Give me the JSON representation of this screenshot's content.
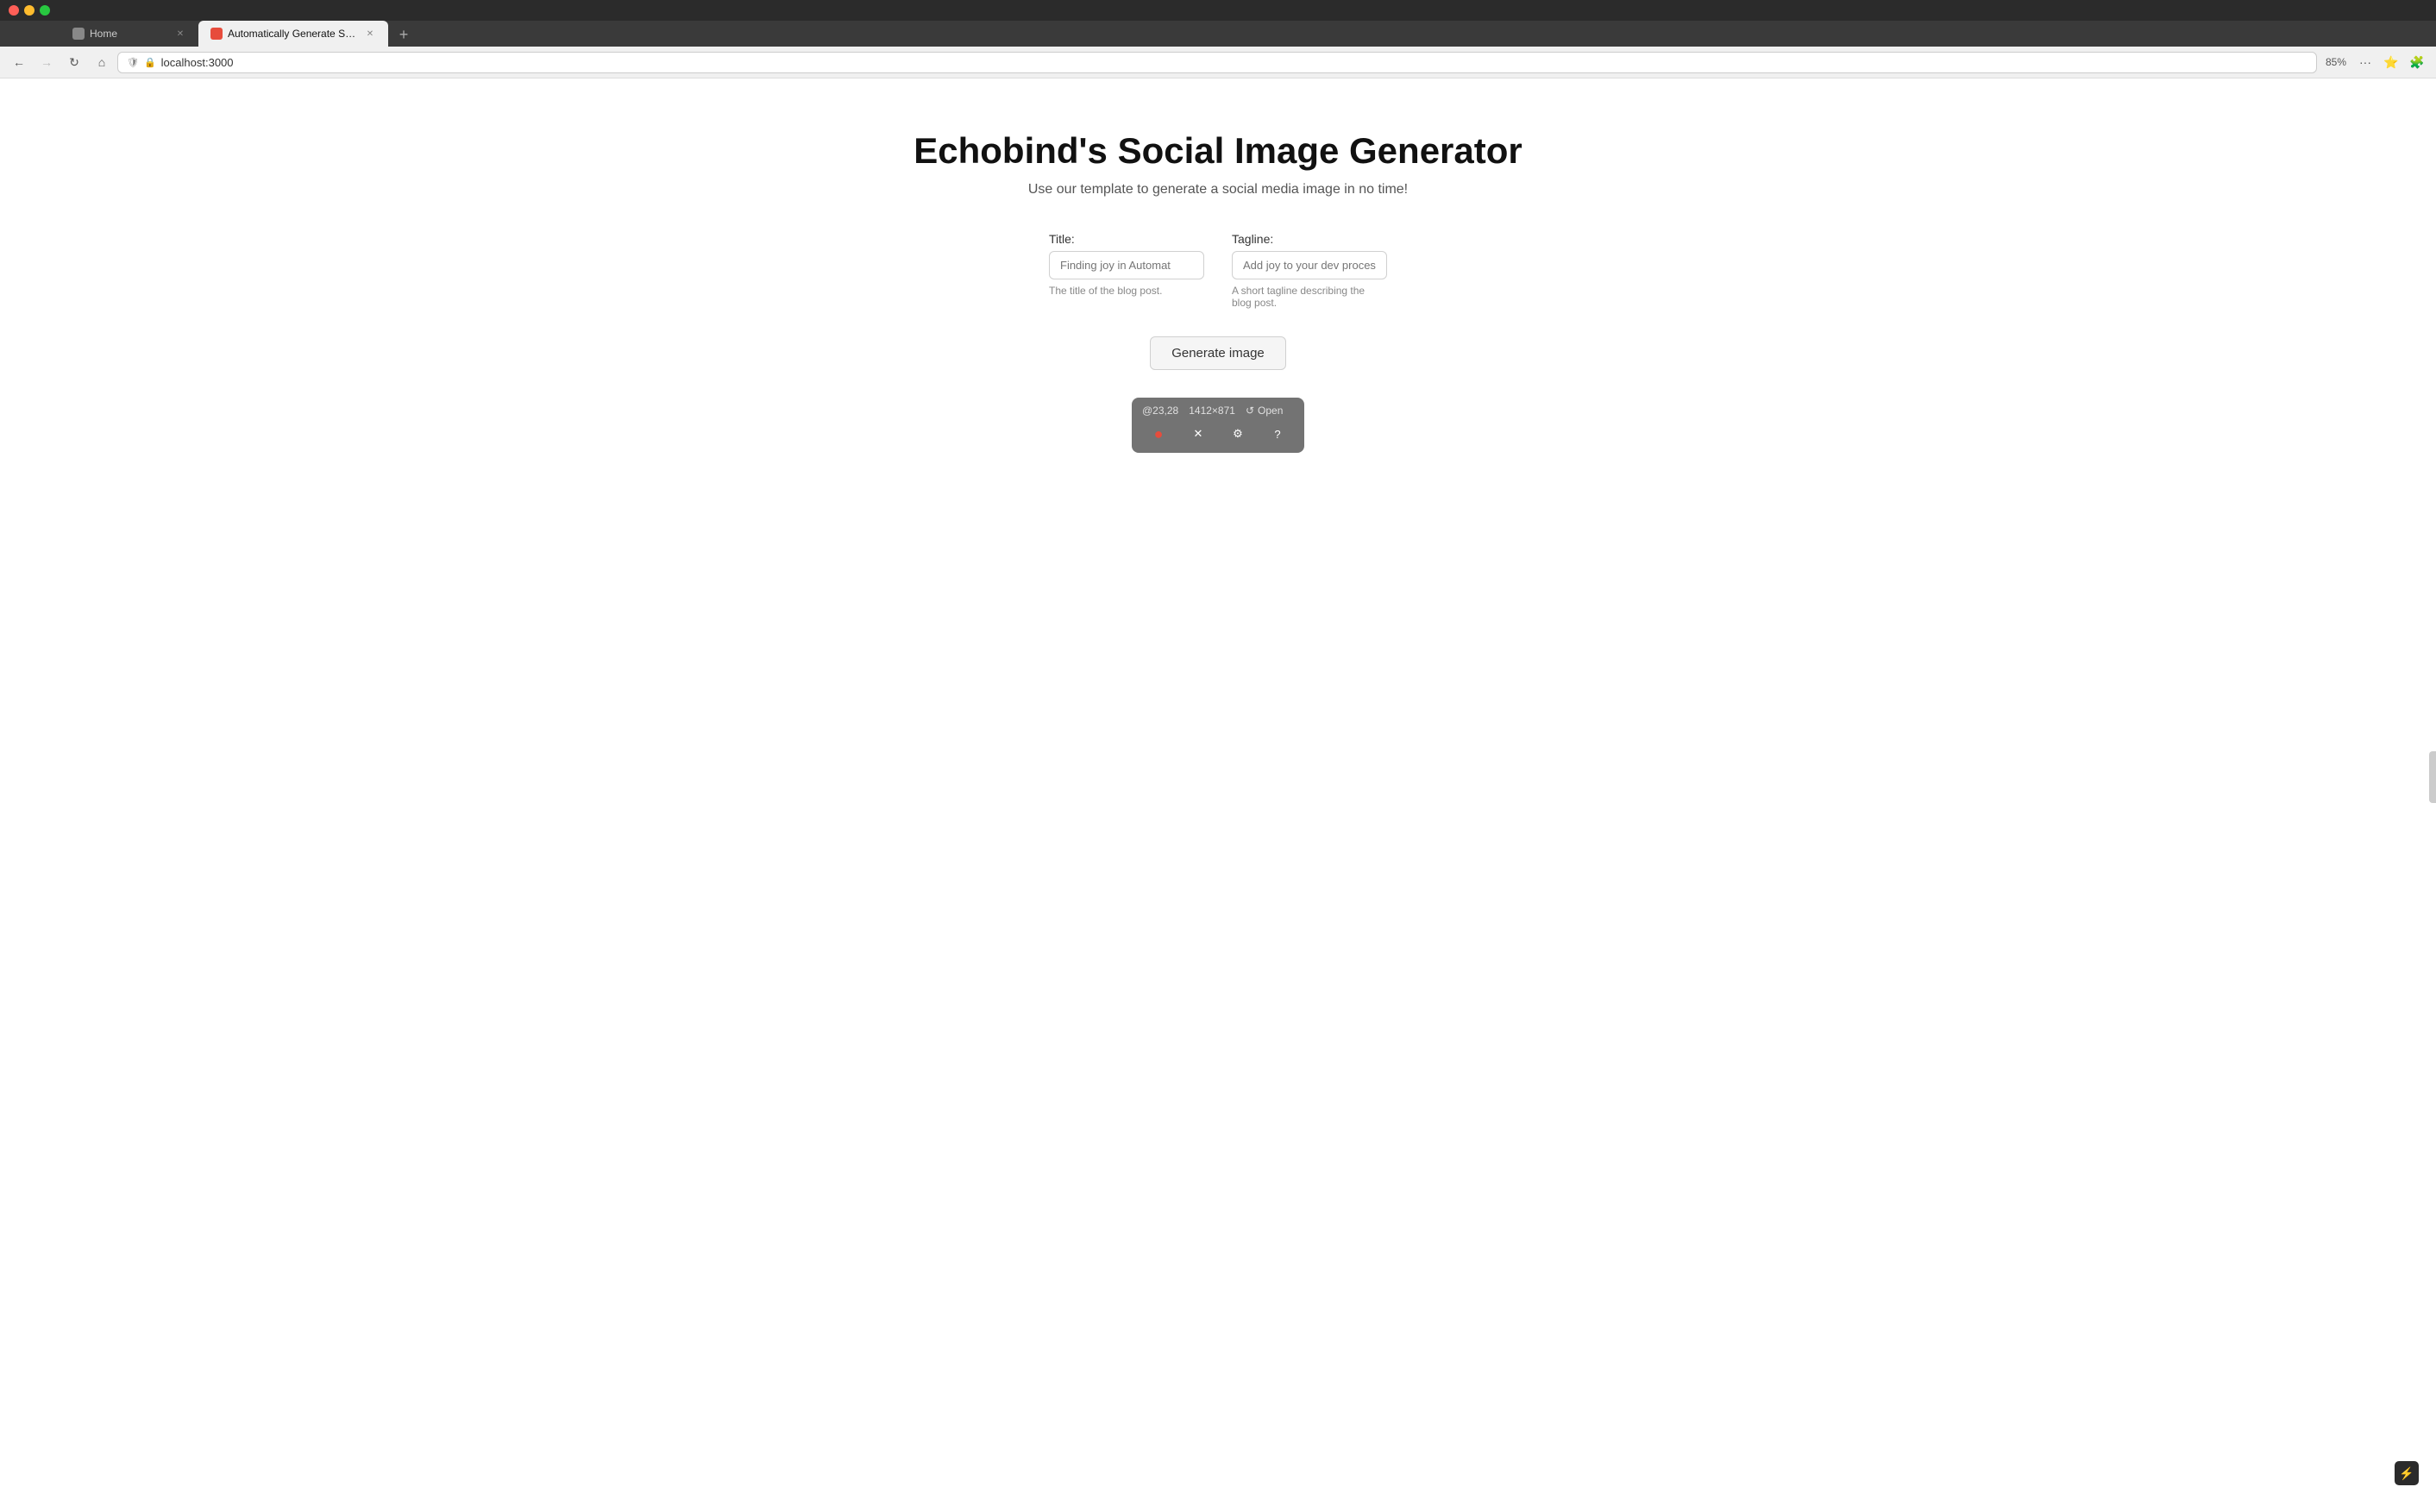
{
  "browser": {
    "traffic_lights": [
      "close",
      "minimize",
      "maximize"
    ],
    "tabs": [
      {
        "id": "home",
        "title": "Home",
        "icon_color": "#888",
        "active": false,
        "closeable": true
      },
      {
        "id": "generator",
        "title": "Automatically Generate Socia",
        "icon_color": "#e74c3c",
        "active": true,
        "closeable": true
      }
    ],
    "new_tab_label": "+",
    "address": "localhost:3000",
    "zoom": "85%",
    "back_disabled": false,
    "forward_disabled": true
  },
  "page": {
    "title": "Echobind's Social Image Generator",
    "subtitle": "Use our template to generate a social media image in no time!",
    "form": {
      "title_label": "Title:",
      "title_placeholder": "Finding joy in Automat",
      "title_hint": "The title of the blog post.",
      "tagline_label": "Tagline:",
      "tagline_placeholder": "Add joy to your dev process w",
      "tagline_hint": "A short tagline describing the blog post."
    },
    "generate_button": "Generate image"
  },
  "devtools_overlay": {
    "coords": "@23,28",
    "dims": "1412×871",
    "open_icon": "↺",
    "open_label": "Open",
    "actions": [
      {
        "id": "record",
        "symbol": "●",
        "label": "record"
      },
      {
        "id": "close",
        "symbol": "✕",
        "label": "close"
      },
      {
        "id": "settings",
        "symbol": "⚙",
        "label": "settings"
      },
      {
        "id": "help",
        "symbol": "?",
        "label": "help"
      }
    ]
  },
  "lightning_icon": "⚡"
}
